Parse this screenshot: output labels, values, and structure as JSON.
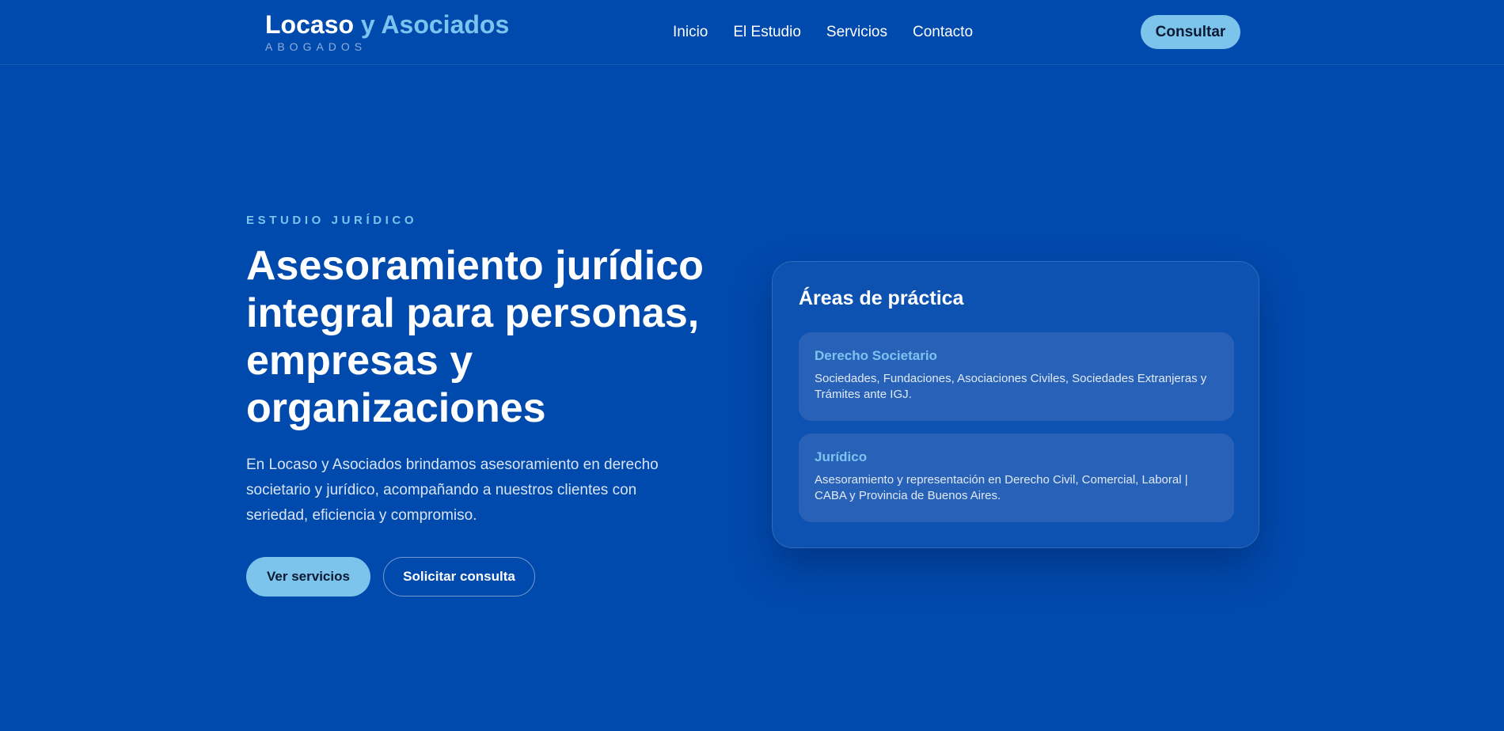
{
  "header": {
    "brand_name_main": "Locaso",
    "brand_name_accent": "y Asociados",
    "brand_subtitle": "ABOGADOS",
    "nav": [
      "Inicio",
      "El Estudio",
      "Servicios",
      "Contacto"
    ],
    "cta_label": "Consultar"
  },
  "hero": {
    "eyebrow": "ESTUDIO JURÍDICO",
    "title": "Asesoramiento jurídico integral para personas, empresas y organizaciones",
    "description": "En Locaso y Asociados brindamos asesoramiento en derecho societario y jurídico, acompañando a nuestros clientes con seriedad, eficiencia y compromiso.",
    "primary_button": "Ver servicios",
    "secondary_button": "Solicitar consulta"
  },
  "practice_card": {
    "title": "Áreas de práctica",
    "items": [
      {
        "name": "Derecho Societario",
        "description": "Sociedades, Fundaciones, Asociaciones Civiles, Sociedades Extranjeras y Trámites ante IGJ."
      },
      {
        "name": "Jurídico",
        "description": "Asesoramiento y representación en Derecho Civil, Comercial, Laboral | CABA y Provincia de Buenos Aires."
      }
    ]
  },
  "colors": {
    "background": "#004aad",
    "accent": "#7cc4f0",
    "card": "#0d52b0",
    "card_item": "#2862b8"
  }
}
